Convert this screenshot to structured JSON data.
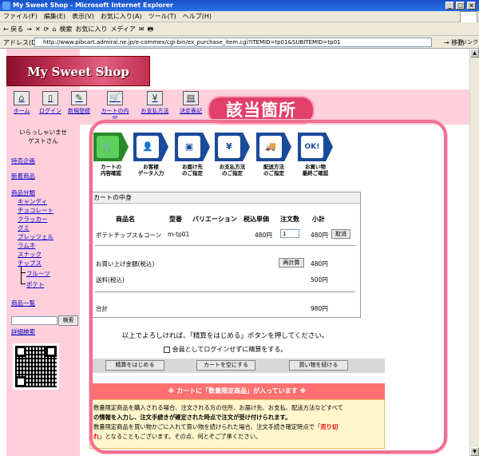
{
  "window": {
    "title": "My Sweet Shop - Microsoft Internet Explorer",
    "min": "_",
    "max": "□",
    "close": "×"
  },
  "menu": [
    "ファイル(F)",
    "編集(E)",
    "表示(V)",
    "お気に入り(A)",
    "ツール(T)",
    "ヘルプ(H)"
  ],
  "toolbar": [
    "← 戻る",
    "→",
    "✕",
    "⟳",
    "⌂",
    "検索",
    "お気に入り",
    "メディア",
    "✉",
    "🖶"
  ],
  "address": {
    "label": "アドレス(D)",
    "url": "http://www.pibcart.admiral.ne.jp/e-commex/cgi-bin/ex_purchase_item.cgi?ITEMID=tp01&SUBITEMID=tp01",
    "go": "→ 移動",
    "links": "リンク"
  },
  "shop": {
    "name": "My Sweet Shop"
  },
  "nav": [
    {
      "label": "ホーム",
      "icon": "⌂"
    },
    {
      "label": "ログイン",
      "icon": "▯"
    },
    {
      "label": "新規登録",
      "icon": "✎"
    },
    {
      "label": "カートの内容",
      "icon": "🛒"
    },
    {
      "label": "お支払方法",
      "icon": "¥"
    },
    {
      "label": "決定表記",
      "icon": "▤"
    }
  ],
  "annotation": "該当箇所",
  "sidebar": {
    "greeting1": "いらっしゃいませ",
    "greeting2": "ゲストさん",
    "links": [
      "特売企画",
      "新着商品",
      "商品分類"
    ],
    "categories": [
      "キャンディ",
      "チョコレート",
      "クラッカー",
      "グミ",
      "プレッツェル",
      "ラムネ",
      "スナック",
      "チップス"
    ],
    "subcats": [
      "フルーツ",
      "ポテト"
    ],
    "list_link": "商品一覧",
    "search_button": "検索",
    "detail_search": "詳細検索"
  },
  "steps": [
    {
      "line1": "カートの",
      "line2": "内容確認",
      "icon": "🛒"
    },
    {
      "line1": "お客様",
      "line2": "データ入力",
      "icon": "👤"
    },
    {
      "line1": "お届け先",
      "line2": "のご指定",
      "icon": "▣"
    },
    {
      "line1": "お支払方法",
      "line2": "のご指定",
      "icon": "¥"
    },
    {
      "line1": "配送方法",
      "line2": "のご指定",
      "icon": "🚚"
    },
    {
      "line1": "お買い物",
      "line2": "最終ご確認",
      "icon": "OK!"
    }
  ],
  "cart": {
    "title": "カートの中身",
    "headers": {
      "name": "商品名",
      "model": "型番",
      "variation": "バリエーション",
      "price": "税込単価",
      "qty": "注文数",
      "subtotal": "小計"
    },
    "item": {
      "name": "ポテトチップス＆コーン",
      "model": "m-tp01",
      "price": "480円",
      "qty": "1",
      "subtotal": "480円",
      "cancel": "取消"
    },
    "total_label": "お買い上げ金額(税込)",
    "recalc": "再計算",
    "total_value": "480円",
    "shipping_label": "送料(税込)",
    "shipping_value": "500円",
    "grand_label": "合計",
    "grand_value": "980円"
  },
  "message1": "以上でよろしければ、「精算をはじめる」ボタンを押してください。",
  "message2": "会員としてログインせずに精算をする。",
  "buttons": {
    "checkout": "精算をはじめる",
    "empty": "カートを空にする",
    "continue": "買い物を続ける"
  },
  "notice": {
    "header": "※ カートに「数量限定商品」が入っています ※",
    "line1": "数量限定商品を購入される場合、注文される方の住所、お届け先、お支払、配送方法などすべて",
    "line2": "の情報を入力し、注文手続きが確定された時点で注文が受け付けられます。",
    "line3a": "数量限定商品を買い物かごに入れて買い物を続けられた場合、注文手続き確定時点で「",
    "line3red": "売り切",
    "line4red": "れ",
    "line4": "」となることもございます。その点、何とぞご了承ください。"
  }
}
